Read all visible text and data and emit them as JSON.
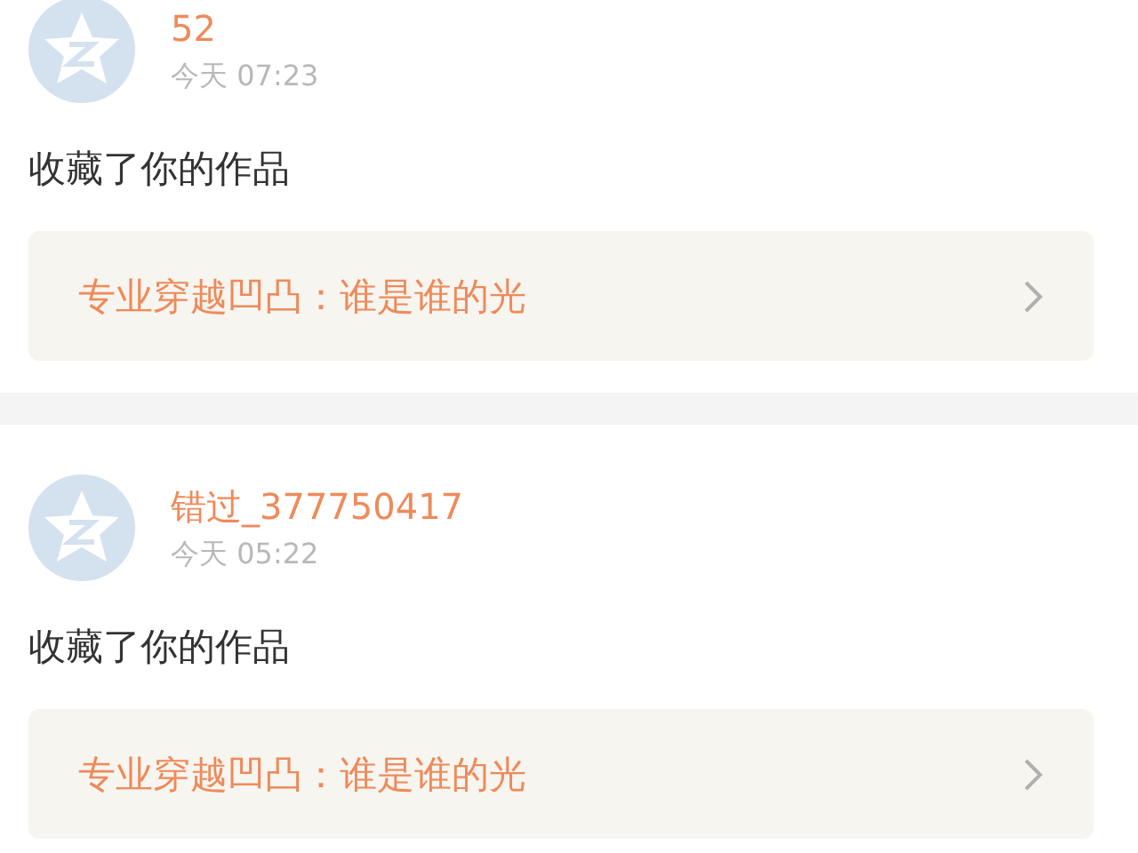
{
  "notifications": [
    {
      "user": "52",
      "time": "今天 07:23",
      "action": "收藏了你的作品",
      "work": {
        "title": "专业穿越凹凸：谁是谁的光"
      }
    },
    {
      "user": "错过_377750417",
      "time": "今天 05:22",
      "action": "收藏了你的作品",
      "work": {
        "title": "专业穿越凹凸：谁是谁的光"
      }
    }
  ]
}
